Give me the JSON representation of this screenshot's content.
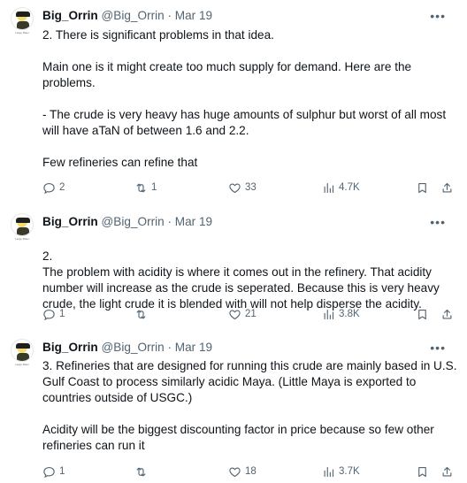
{
  "tweets": [
    {
      "name": "Big_Orrin",
      "handle": "@Big_Orrin",
      "separator": "·",
      "date": "Mar 19",
      "avatar_caption": "Largo Riser",
      "paragraphs": [
        "2. There is significant problems in that idea.",
        "Main one is it might create too much supply for demand. Here are the problems.",
        "- The crude is very heavy has huge amounts of sulphur but worst of all most will have aTaN of between 1.6 and 2.2.",
        "Few refineries can refine that"
      ],
      "replies": "2",
      "reposts": "1",
      "likes": "33",
      "views": "4.7K"
    },
    {
      "name": "Big_Orrin",
      "handle": "@Big_Orrin",
      "separator": "·",
      "date": "Mar 19",
      "avatar_caption": "Largo Riser",
      "paragraphs": [
        "2.\nThe problem with acidity is where it comes out in the refinery. That acidity number will increase as the crude is seperated. Because this is very heavy crude, the light crude it is blended with will not help disperse the acidity."
      ],
      "replies": "1",
      "reposts": "",
      "likes": "21",
      "views": "3.8K"
    },
    {
      "name": "Big_Orrin",
      "handle": "@Big_Orrin",
      "separator": "·",
      "date": "Mar 19",
      "avatar_caption": "Largo Riser",
      "paragraphs": [
        "3. Refineries that are designed for running this crude are mainly based in U.S. Gulf Coast to process similarly acidic Maya. (Little Maya is exported to countries outside of USGC.)",
        "Acidity will be the biggest discounting factor in price because so few other refineries can run it"
      ],
      "replies": "1",
      "reposts": "",
      "likes": "18",
      "views": "3.7K"
    }
  ],
  "icons": {
    "more": "more-icon",
    "reply": "reply-icon",
    "repost": "repost-icon",
    "like": "heart-icon",
    "views": "views-icon",
    "bookmark": "bookmark-icon",
    "share": "share-icon"
  },
  "colors": {
    "text": "#0f1419",
    "secondary": "#536471"
  }
}
